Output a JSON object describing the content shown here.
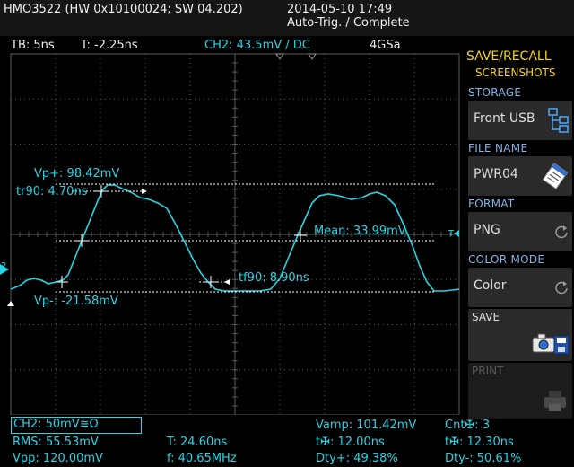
{
  "header": {
    "model": "HMO3522 (HW 0x10100024; SW 04.202)",
    "datetime": "2014-05-10 17:49",
    "status": "Auto-Trig. / Complete"
  },
  "infobar": {
    "timebase": "TB: 5ns",
    "trigger_time": "T: -2.25ns",
    "channel_trigger": "CH2: 43.5mV / DC",
    "sample_rate": "4GSa"
  },
  "waveform_annotations": {
    "vp_plus": "Vp+: 98.42mV",
    "tr90": "tr90: 4.70ns",
    "mean": "Mean: 33.99mV",
    "tf90": "tf90: 8.90ns",
    "vp_minus": "Vp-: -21.58mV",
    "channel_marker": "2",
    "trigger_marker": "T"
  },
  "side_panel": {
    "title": "SAVE/RECALL",
    "subtitle": "SCREENSHOTS",
    "storage_label": "STORAGE",
    "storage_value": "Front USB",
    "filename_label": "FILE NAME",
    "filename_value": "PWR04",
    "format_label": "FORMAT",
    "format_value": "PNG",
    "colormode_label": "COLOR MODE",
    "colormode_value": "Color",
    "save_label": "SAVE",
    "print_label": "PRINT"
  },
  "measurements": {
    "ch2_setting": "CH2: 50mV≅Ω",
    "rms": "RMS: 55.53mV",
    "vpp": "Vpp: 120.00mV",
    "period": "T: 24.60ns",
    "freq": "f: 40.65MHz",
    "vamp": "Vamp: 101.42mV",
    "rise": "t✠: 12.00ns",
    "dty_plus": "Dty+: 49.38%",
    "cnt": "Cnt✠: 3",
    "fall": "t✠: 12.30ns",
    "dty_minus": "Dty-: 50.61%"
  },
  "colors": {
    "trace": "#24d6e6",
    "accent": "#f2d21a",
    "label": "#7fb6ea",
    "grid": "#5a5a5a"
  },
  "icons": [
    "folder-tree-icon",
    "file-card-icon",
    "refresh-icon",
    "camera-save-icon",
    "printer-icon"
  ]
}
